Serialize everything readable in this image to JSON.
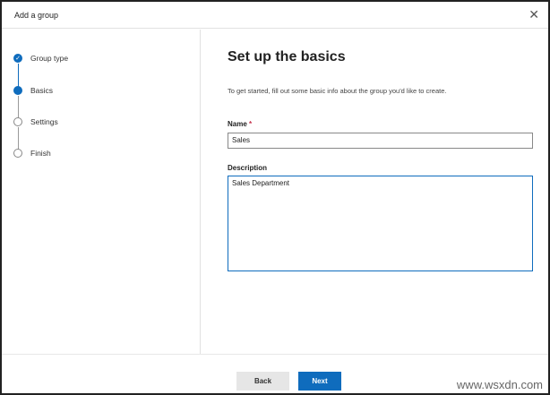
{
  "dialog": {
    "title": "Add a group",
    "close_icon": "close-icon"
  },
  "steps": [
    {
      "label": "Group type",
      "state": "done"
    },
    {
      "label": "Basics",
      "state": "current"
    },
    {
      "label": "Settings",
      "state": "pending"
    },
    {
      "label": "Finish",
      "state": "pending"
    }
  ],
  "main": {
    "heading": "Set up the basics",
    "intro": "To get started, fill out some basic info about the group you'd like to create.",
    "name_label": "Name",
    "required_mark": "*",
    "name_value": "Sales",
    "description_label": "Description",
    "description_value": "Sales Department"
  },
  "footer": {
    "back": "Back",
    "next": "Next"
  },
  "watermark": "www.wsxdn.com",
  "colors": {
    "accent": "#0f6cbd"
  }
}
